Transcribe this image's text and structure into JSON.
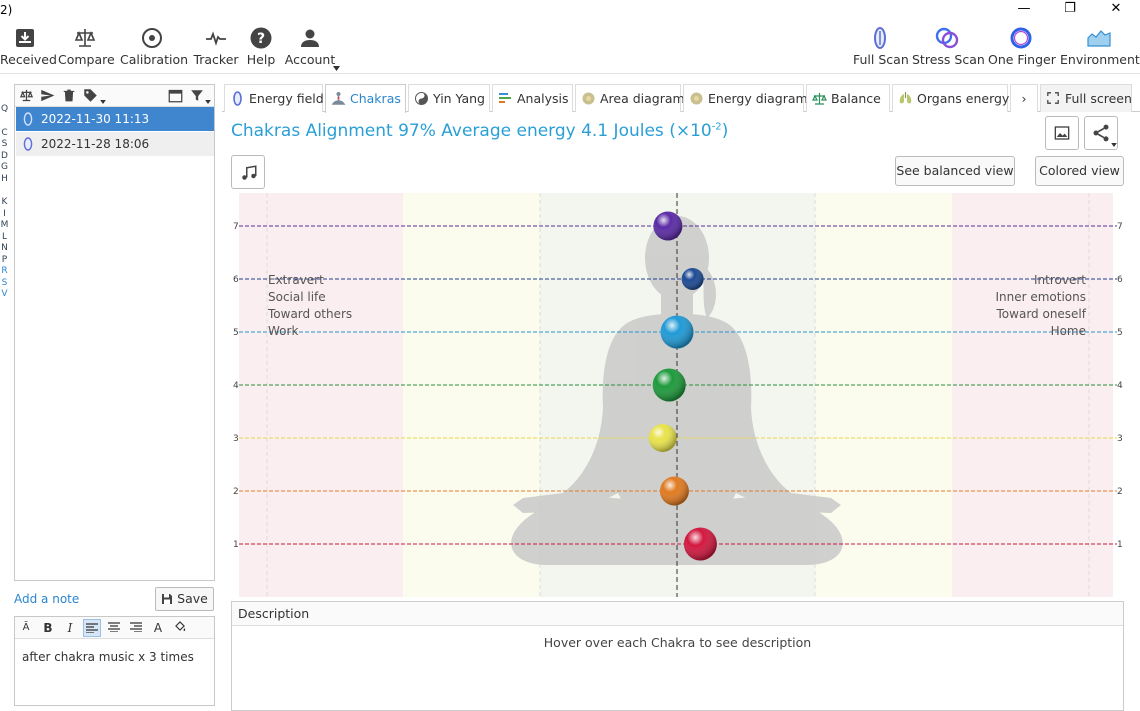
{
  "window": {
    "title_fragment": "2)",
    "minimize": "—",
    "maximize": "❐",
    "close": "✕"
  },
  "toolbar": {
    "left": [
      {
        "label": "Received",
        "icon": "inbox-download-icon"
      },
      {
        "label": "Compare",
        "icon": "scales-icon"
      },
      {
        "label": "Calibration",
        "icon": "target-icon"
      },
      {
        "label": "Tracker",
        "icon": "pulse-icon"
      },
      {
        "label": "Help",
        "icon": "help-icon"
      },
      {
        "label": "Account",
        "icon": "user-icon"
      }
    ],
    "right": [
      {
        "label": "Full Scan",
        "icon": "fullscan-icon"
      },
      {
        "label": "Stress Scan",
        "icon": "stress-scan-icon"
      },
      {
        "label": "One Finger",
        "icon": "one-finger-icon"
      },
      {
        "label": "Environment",
        "icon": "environment-icon"
      }
    ]
  },
  "left_strip": [
    "Q",
    "C",
    "S",
    "D",
    "G",
    "H",
    "K",
    "I",
    "M",
    "L",
    "N",
    "P",
    "R",
    "S",
    "V"
  ],
  "sessions": [
    {
      "label": "2022-11-30 11:13",
      "selected": true
    },
    {
      "label": "2022-11-28 18:06",
      "selected": false
    }
  ],
  "notes": {
    "add_note": "Add a note",
    "save": "Save",
    "text": "after chakra music x 3 times",
    "format_buttons": [
      "B",
      "I",
      "A"
    ]
  },
  "tabs": [
    {
      "label": "Energy field",
      "active": false
    },
    {
      "label": "Chakras",
      "active": true
    },
    {
      "label": "Yin Yang",
      "active": false
    },
    {
      "label": "Analysis",
      "active": false
    },
    {
      "label": "Area diagram",
      "active": false
    },
    {
      "label": "Energy diagram",
      "active": false
    },
    {
      "label": "Balance",
      "active": false
    },
    {
      "label": "Organs energy",
      "active": false
    }
  ],
  "tab_more": "›",
  "fullscreen": "Full screen",
  "main": {
    "title_prefix": "Chakras Alignment 97% Average energy 4.1 Joules (×10",
    "title_exp": "-2",
    "title_suffix": ")",
    "balanced_view": "See balanced view",
    "colored_view": "Colored view"
  },
  "chakra_view": {
    "left_labels": [
      "Extravert",
      "Social life",
      "Toward others",
      "Work"
    ],
    "right_labels": [
      "Introvert",
      "Inner emotions",
      "Toward oneself",
      "Home"
    ],
    "levels": [
      "7",
      "6",
      "5",
      "4",
      "3",
      "2",
      "1"
    ],
    "level_colors": [
      "#5a2d9c",
      "#1f3f8f",
      "#2596d0",
      "#2a8f3a",
      "#e6d84a",
      "#e07b28",
      "#c8193c"
    ],
    "chakras": [
      {
        "level": 7,
        "offset": -0.07,
        "color": "#5b2ba6"
      },
      {
        "level": 6,
        "offset": 0.12,
        "color": "#1c4a94"
      },
      {
        "level": 5,
        "offset": 0.0,
        "color": "#1f9ad6"
      },
      {
        "level": 4,
        "offset": -0.06,
        "color": "#1e9a3c"
      },
      {
        "level": 3,
        "offset": -0.11,
        "color": "#e8e34a"
      },
      {
        "level": 2,
        "offset": -0.02,
        "color": "#e07a20"
      },
      {
        "level": 1,
        "offset": 0.18,
        "color": "#d2183f"
      }
    ]
  },
  "description": {
    "header": "Description",
    "hint": "Hover over each Chakra to see description"
  }
}
